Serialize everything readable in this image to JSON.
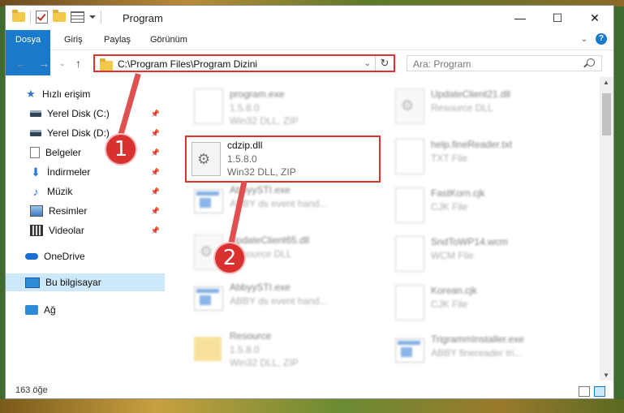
{
  "window": {
    "title": "Program"
  },
  "ribbon": {
    "tabs": [
      "Dosya",
      "Giriş",
      "Paylaş",
      "Görünüm"
    ]
  },
  "address": {
    "path": "C:\\Program Files\\Program Dizini"
  },
  "search": {
    "placeholder": "Ara: Program"
  },
  "sidebar": {
    "items": [
      {
        "label": "Hızlı erişim"
      },
      {
        "label": "Yerel Disk (C:)"
      },
      {
        "label": "Yerel Disk (D:)"
      },
      {
        "label": "Belgeler"
      },
      {
        "label": "İndirmeler"
      },
      {
        "label": "Müzik"
      },
      {
        "label": "Resimler"
      },
      {
        "label": "Videolar"
      },
      {
        "label": "OneDrive"
      },
      {
        "label": "Bu bilgisayar"
      },
      {
        "label": "Ağ"
      }
    ]
  },
  "files": {
    "left": [
      {
        "name": "program.exe",
        "version": "1.5.8.0",
        "type": "Win32 DLL, ZIP"
      },
      {
        "name": "cdzip.dll",
        "version": "1.5.8.0",
        "type": "Win32 DLL, ZIP"
      },
      {
        "name": "AbbyySTI.exe",
        "version": "",
        "type": "ABBY ds event hand..."
      },
      {
        "name": "UpdateClient65.dll",
        "version": "",
        "type": "Resource DLL"
      },
      {
        "name": "AbbyySTI.exe",
        "version": "",
        "type": "ABBY ds event hand..."
      },
      {
        "name": "Resource",
        "version": "1.5.8.0",
        "type": "Win32 DLL, ZIP"
      }
    ],
    "right": [
      {
        "name": "UpdateClient21.dll",
        "type": "Resource DLL"
      },
      {
        "name": "help.fineReader.txt",
        "type": "TXT File"
      },
      {
        "name": "FastKorn.cjk",
        "type": "CJK File"
      },
      {
        "name": "SndToWP14.wcm",
        "type": "WCM File"
      },
      {
        "name": "Korean.cjk",
        "type": "CJK File"
      },
      {
        "name": "TrigrammInstaller.exe",
        "type": "ABBY finereader tri..."
      }
    ]
  },
  "status": {
    "count": "163 öğe"
  },
  "annotations": {
    "badge1": "1",
    "badge2": "2"
  }
}
